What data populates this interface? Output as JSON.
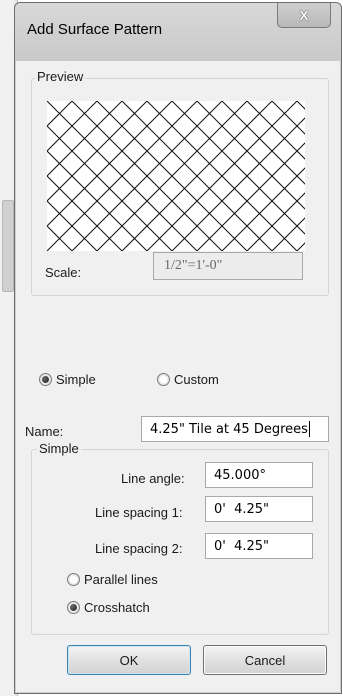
{
  "window": {
    "title": "Add Surface Pattern",
    "close_glyph": "X"
  },
  "preview": {
    "group_label": "Preview",
    "pattern": "crosshatch",
    "scale_label": "Scale:",
    "scale_value": "1/2\"=1'-0\""
  },
  "pattern_type": {
    "options": [
      {
        "label": "Simple",
        "checked": true
      },
      {
        "label": "Custom",
        "checked": false
      }
    ]
  },
  "name": {
    "label": "Name:",
    "value": "4.25\" Tile at 45 Degrees"
  },
  "simple": {
    "group_label": "Simple",
    "line_angle_label": "Line angle:",
    "line_angle_value": "45.000°",
    "line_spacing_1_label": "Line spacing 1:",
    "line_spacing_1_value": "0'  4.25\"",
    "line_spacing_2_label": "Line spacing 2:",
    "line_spacing_2_value": "0'  4.25\"",
    "modes": [
      {
        "label": "Parallel lines",
        "checked": false
      },
      {
        "label": "Crosshatch",
        "checked": true
      }
    ]
  },
  "buttons": {
    "ok": "OK",
    "cancel": "Cancel"
  }
}
